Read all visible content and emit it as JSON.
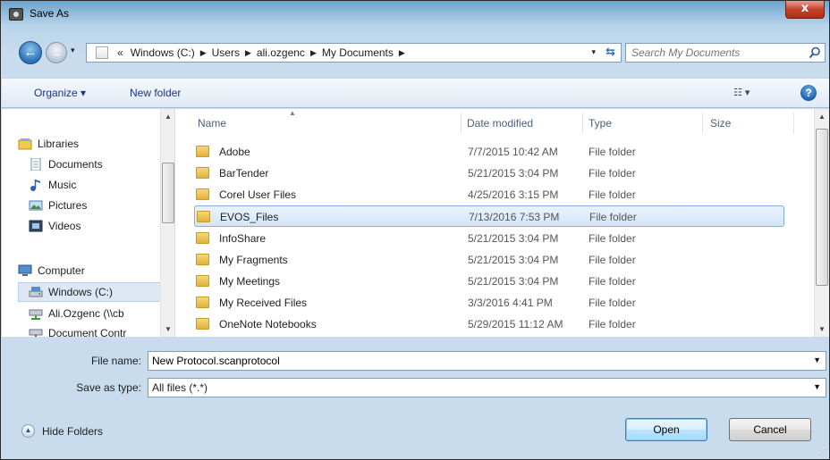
{
  "window": {
    "title": "Save As",
    "close_glyph": "x"
  },
  "address": {
    "overflow": "«",
    "crumbs": [
      "Windows (C:)",
      "Users",
      "ali.ozgenc",
      "My Documents"
    ],
    "search_placeholder": "Search My Documents"
  },
  "toolbar": {
    "organize_label": "Organize ▾",
    "new_folder_label": "New folder",
    "help_glyph": "?"
  },
  "nav": {
    "items": [
      {
        "label": "Libraries",
        "icon": "libraries-icon"
      },
      {
        "label": "Documents",
        "icon": "documents-icon"
      },
      {
        "label": "Music",
        "icon": "music-icon"
      },
      {
        "label": "Pictures",
        "icon": "pictures-icon"
      },
      {
        "label": "Videos",
        "icon": "videos-icon"
      },
      {
        "label": "Computer",
        "icon": "computer-icon"
      },
      {
        "label": "Windows (C:)",
        "icon": "drive-icon"
      },
      {
        "label": "Ali.Ozgenc (\\\\cb",
        "icon": "network-drive-icon"
      },
      {
        "label": "Document Contr",
        "icon": "network-drive-icon"
      }
    ]
  },
  "files": {
    "headers": {
      "name": "Name",
      "date": "Date modified",
      "type": "Type",
      "size": "Size"
    },
    "rows": [
      {
        "name": "Adobe",
        "date": "7/7/2015 10:42 AM",
        "type": "File folder"
      },
      {
        "name": "BarTender",
        "date": "5/21/2015 3:04 PM",
        "type": "File folder"
      },
      {
        "name": "Corel User Files",
        "date": "4/25/2016 3:15 PM",
        "type": "File folder"
      },
      {
        "name": "EVOS_Files",
        "date": "7/13/2016 7:53 PM",
        "type": "File folder"
      },
      {
        "name": "InfoShare",
        "date": "5/21/2015 3:04 PM",
        "type": "File folder"
      },
      {
        "name": "My Fragments",
        "date": "5/21/2015 3:04 PM",
        "type": "File folder"
      },
      {
        "name": "My Meetings",
        "date": "5/21/2015 3:04 PM",
        "type": "File folder"
      },
      {
        "name": "My Received Files",
        "date": "3/3/2016 4:41 PM",
        "type": "File folder"
      },
      {
        "name": "OneNote Notebooks",
        "date": "5/29/2015 11:12 AM",
        "type": "File folder"
      }
    ]
  },
  "form": {
    "file_name_label": "File name:",
    "file_name_value": "New Protocol.scanprotocol",
    "save_as_type_label": "Save as type:",
    "save_as_type_value": "All files (*.*)"
  },
  "footer": {
    "hide_folders_label": "Hide Folders",
    "open_label": "Open",
    "cancel_label": "Cancel"
  },
  "colors": {
    "accent": "#3c7fb1",
    "selection": "#d4e6f8",
    "titlebar": "#6aa4cf"
  }
}
